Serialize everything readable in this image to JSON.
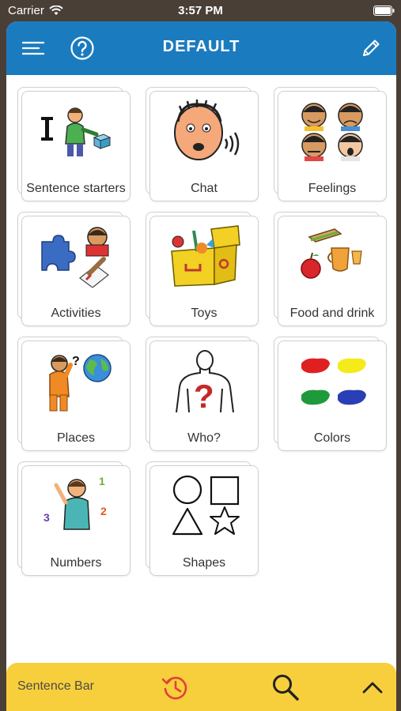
{
  "status_bar": {
    "carrier": "Carrier",
    "time": "3:57 PM"
  },
  "header": {
    "title": "DEFAULT",
    "menu_icon": "menu-icon",
    "help_icon": "help-icon",
    "edit_icon": "pencil-icon"
  },
  "tiles": [
    {
      "label": "Sentence starters",
      "icon": "sentence-starters-icon"
    },
    {
      "label": "Chat",
      "icon": "chat-icon"
    },
    {
      "label": "Feelings",
      "icon": "feelings-icon"
    },
    {
      "label": "Activities",
      "icon": "activities-icon"
    },
    {
      "label": "Toys",
      "icon": "toys-icon"
    },
    {
      "label": "Food and drink",
      "icon": "food-drink-icon"
    },
    {
      "label": "Places",
      "icon": "places-icon"
    },
    {
      "label": "Who?",
      "icon": "who-icon"
    },
    {
      "label": "Colors",
      "icon": "colors-icon"
    },
    {
      "label": "Numbers",
      "icon": "numbers-icon"
    },
    {
      "label": "Shapes",
      "icon": "shapes-icon"
    }
  ],
  "bottom_bar": {
    "label": "Sentence Bar",
    "history_icon": "history-icon",
    "search_icon": "search-icon",
    "expand_icon": "chevron-up-icon"
  },
  "colors": {
    "header": "#1b7bbf",
    "bottom_bar": "#f7cf3c",
    "history": "#e0413a"
  }
}
